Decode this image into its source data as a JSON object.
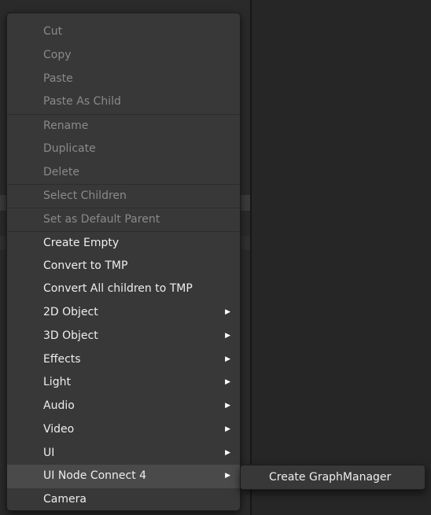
{
  "context_menu": {
    "items": [
      {
        "label": "Cut",
        "enabled": false,
        "has_submenu": false
      },
      {
        "label": "Copy",
        "enabled": false,
        "has_submenu": false
      },
      {
        "label": "Paste",
        "enabled": false,
        "has_submenu": false
      },
      {
        "label": "Paste As Child",
        "enabled": false,
        "has_submenu": false
      },
      {
        "label": "Rename",
        "enabled": false,
        "has_submenu": false
      },
      {
        "label": "Duplicate",
        "enabled": false,
        "has_submenu": false
      },
      {
        "label": "Delete",
        "enabled": false,
        "has_submenu": false
      },
      {
        "label": "Select Children",
        "enabled": false,
        "has_submenu": false
      },
      {
        "label": "Set as Default Parent",
        "enabled": false,
        "has_submenu": false
      },
      {
        "label": "Create Empty",
        "enabled": true,
        "has_submenu": false
      },
      {
        "label": "Convert to TMP",
        "enabled": true,
        "has_submenu": false
      },
      {
        "label": "Convert All children to TMP",
        "enabled": true,
        "has_submenu": false
      },
      {
        "label": "2D Object",
        "enabled": true,
        "has_submenu": true
      },
      {
        "label": "3D Object",
        "enabled": true,
        "has_submenu": true
      },
      {
        "label": "Effects",
        "enabled": true,
        "has_submenu": true
      },
      {
        "label": "Light",
        "enabled": true,
        "has_submenu": true
      },
      {
        "label": "Audio",
        "enabled": true,
        "has_submenu": true
      },
      {
        "label": "Video",
        "enabled": true,
        "has_submenu": true
      },
      {
        "label": "UI",
        "enabled": true,
        "has_submenu": true
      },
      {
        "label": "UI Node Connect 4",
        "enabled": true,
        "has_submenu": true
      },
      {
        "label": "Camera",
        "enabled": true,
        "has_submenu": false
      }
    ],
    "submenu_arrow": "▶"
  },
  "submenu": {
    "items": [
      {
        "label": "Create GraphManager"
      }
    ]
  },
  "colors": {
    "menu_bg": "#383838",
    "highlight_bg": "#4a4a4a",
    "text_enabled": "#eeeeee",
    "text_disabled": "#8a8a8a"
  }
}
